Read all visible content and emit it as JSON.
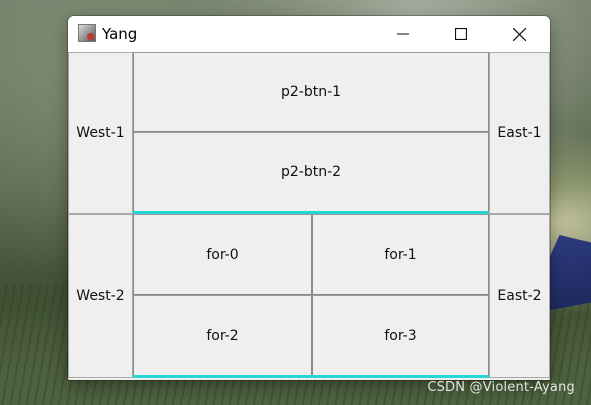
{
  "window": {
    "title": "Yang",
    "icon": "java-app-icon",
    "controls": [
      "minimize-icon",
      "maximize-icon",
      "close-icon"
    ]
  },
  "rows": [
    {
      "west": "West-1",
      "east": "East-1",
      "center": [
        "p2-btn-1",
        "p2-btn-2"
      ]
    },
    {
      "west": "West-2",
      "east": "East-2",
      "center": [
        "for-0",
        "for-1",
        "for-2",
        "for-3"
      ]
    }
  ],
  "colors": {
    "accent_line": "#27d6d6",
    "window_bg": "#f0f0f0",
    "button_bg": "#efefef"
  },
  "watermark": "CSDN @Violent-Ayang"
}
